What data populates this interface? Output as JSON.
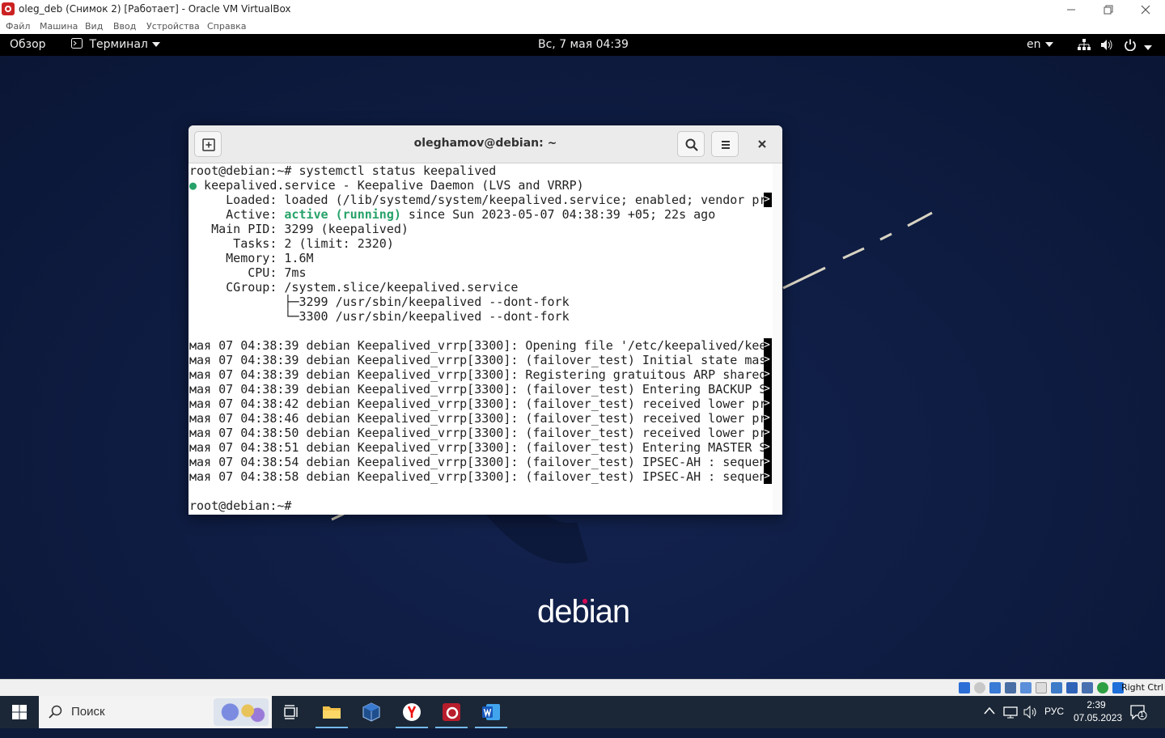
{
  "host_window": {
    "title": "oleg_deb (Снимок 2) [Работает] - Oracle VM VirtualBox",
    "menu": [
      "Файл",
      "Машина",
      "Вид",
      "Ввод",
      "Устройства",
      "Справка"
    ]
  },
  "gnome_bar": {
    "overview": "Обзор",
    "app_menu": "Терминал",
    "clock": "Вс, 7 мая  04:39",
    "keyboard_layout": "en"
  },
  "terminal": {
    "title": "oleghamov@debian: ~",
    "lines": {
      "l0": "root@debian:~# systemctl status keepalived",
      "l1_bullet": "●",
      "l1": " keepalived.service - Keepalive Daemon (LVS and VRRP)",
      "l2": "     Loaded: loaded (/lib/systemd/system/keepalived.service; enabled; vendor pr",
      "l3_label": "     Active: ",
      "l3_status": "active (running)",
      "l3_rest": " since Sun 2023-05-07 04:38:39 +05; 22s ago",
      "l4": "   Main PID: 3299 (keepalived)",
      "l5": "      Tasks: 2 (limit: 2320)",
      "l6": "     Memory: 1.6M",
      "l7": "        CPU: 7ms",
      "l8": "     CGroup: /system.slice/keepalived.service",
      "l9": "             ├─3299 /usr/sbin/keepalived --dont-fork",
      "l10": "             └─3300 /usr/sbin/keepalived --dont-fork",
      "l12": "мая 07 04:38:39 debian Keepalived_vrrp[3300]: Opening file '/etc/keepalived/kee",
      "l13": "мая 07 04:38:39 debian Keepalived_vrrp[3300]: (failover_test) Initial state mas",
      "l14": "мая 07 04:38:39 debian Keepalived_vrrp[3300]: Registering gratuitous ARP shared",
      "l15": "мая 07 04:38:39 debian Keepalived_vrrp[3300]: (failover_test) Entering BACKUP S",
      "l16": "мая 07 04:38:42 debian Keepalived_vrrp[3300]: (failover_test) received lower pr",
      "l17": "мая 07 04:38:46 debian Keepalived_vrrp[3300]: (failover_test) received lower pr",
      "l18": "мая 07 04:38:50 debian Keepalived_vrrp[3300]: (failover_test) received lower pr",
      "l19": "мая 07 04:38:51 debian Keepalived_vrrp[3300]: (failover_test) Entering MASTER S",
      "l20": "мая 07 04:38:54 debian Keepalived_vrrp[3300]: (failover_test) IPSEC-AH : sequen",
      "l21": "мая 07 04:38:58 debian Keepalived_vrrp[3300]: (failover_test) IPSEC-AH : sequen",
      "l23": "root@debian:~# "
    },
    "truncation_marker": ">"
  },
  "desktop": {
    "logo": "debian"
  },
  "vb_status": {
    "host_key": "Right Ctrl"
  },
  "taskbar": {
    "search_placeholder": "Поиск",
    "language": "РУС",
    "time": "2:39",
    "date": "07.05.2023",
    "notifications": "1"
  }
}
